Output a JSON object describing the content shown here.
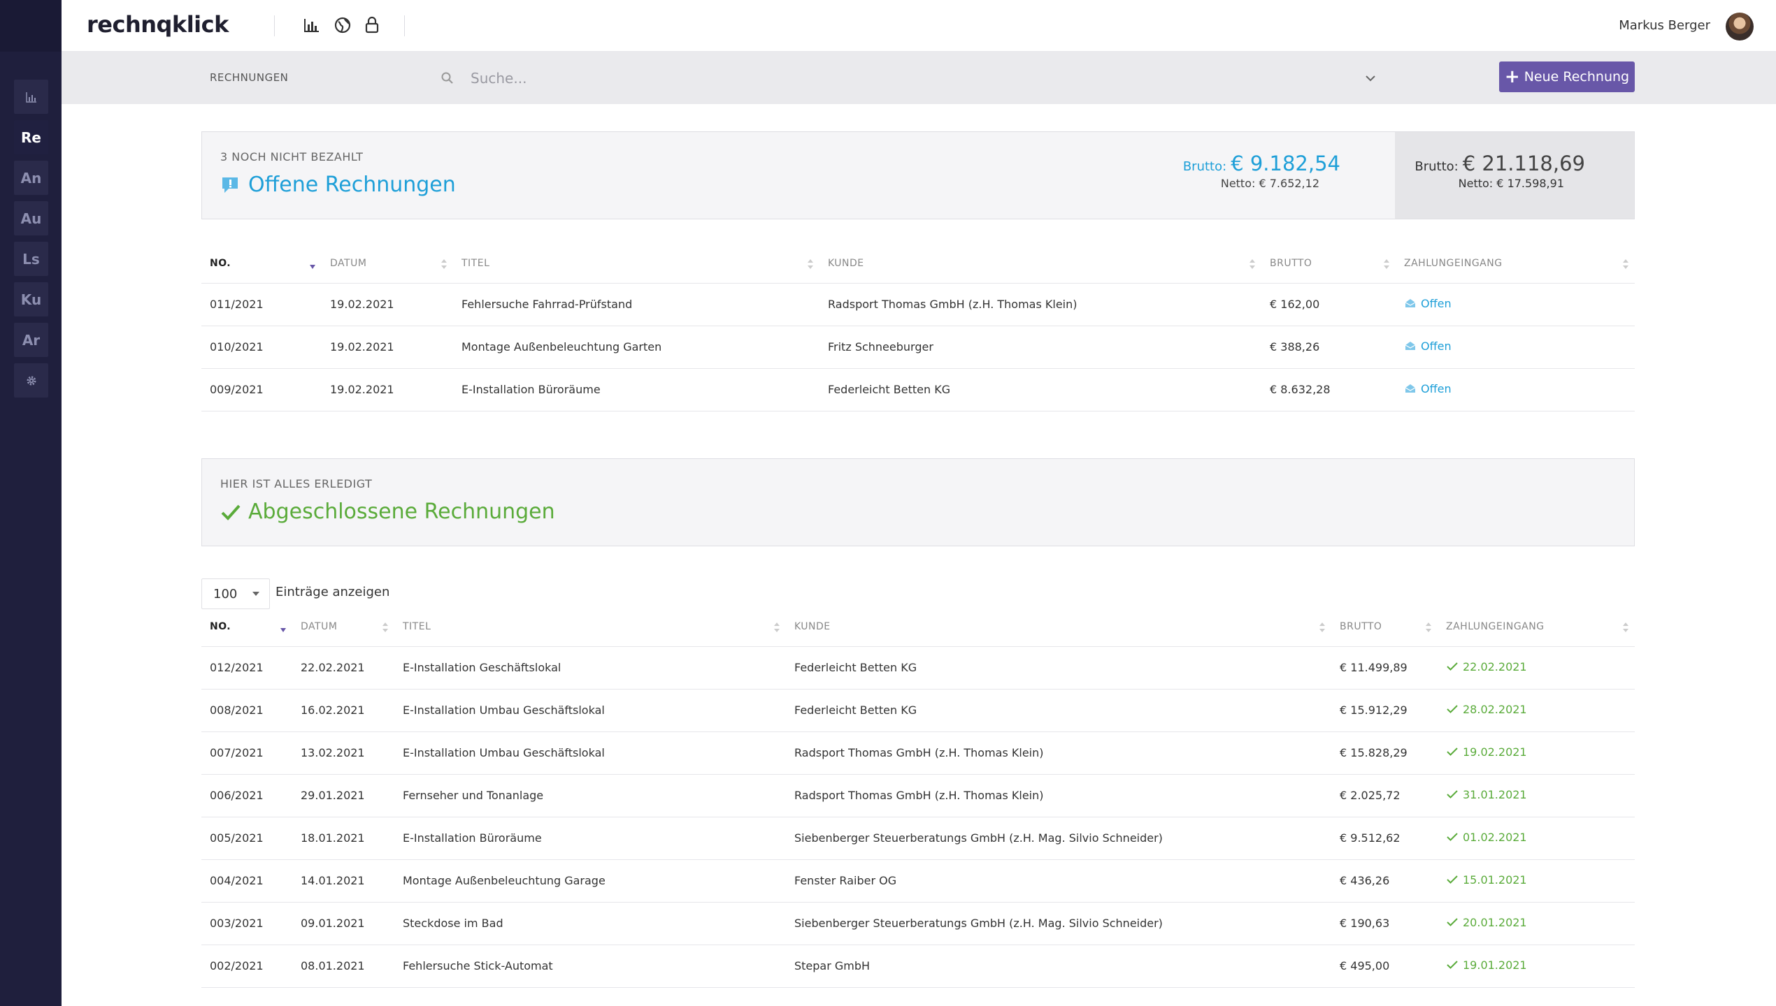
{
  "app": {
    "logo": "rechnqklick"
  },
  "user": {
    "name": "Markus Berger"
  },
  "sidebar": {
    "items": [
      {
        "label": "",
        "icon": "chart-icon"
      },
      {
        "label": "Re",
        "active": true
      },
      {
        "label": "An"
      },
      {
        "label": "Au"
      },
      {
        "label": "Ls"
      },
      {
        "label": "Ku"
      },
      {
        "label": "Ar"
      },
      {
        "label": "",
        "icon": "gear-icon"
      }
    ]
  },
  "header_icons": [
    "chart-icon",
    "globe-icon",
    "lock-icon"
  ],
  "toolbar": {
    "breadcrumb": "RECHNUNGEN",
    "search_placeholder": "Suche...",
    "new_button_label": "Neue Rechnung"
  },
  "open_panel": {
    "eyebrow": "3 NOCH NICHT BEZAHLT",
    "title": "Offene Rechnungen",
    "brutto_label": "Brutto:",
    "brutto_value": "€ 9.182,54",
    "netto_label": "Netto:",
    "netto_value": "€ 7.652,12",
    "total_brutto_label": "Brutto:",
    "total_brutto_value": "€ 21.118,69",
    "total_netto_label": "Netto:",
    "total_netto_value": "€ 17.598,91"
  },
  "open_table": {
    "headers": [
      "NO.",
      "DATUM",
      "TITEL",
      "KUNDE",
      "BRUTTO",
      "ZAHLUNGEINGANG"
    ],
    "rows": [
      [
        "011/2021",
        "19.02.2021",
        "Fehlersuche Fahrrad-Prüfstand",
        "Radsport Thomas GmbH (z.H. Thomas Klein)",
        "€ 162,00",
        "Offen"
      ],
      [
        "010/2021",
        "19.02.2021",
        "Montage Außenbeleuchtung Garten",
        "Fritz Schneeburger",
        "€ 388,26",
        "Offen"
      ],
      [
        "009/2021",
        "19.02.2021",
        "E-Installation Büroräume",
        "Federleicht Betten KG",
        "€ 8.632,28",
        "Offen"
      ]
    ]
  },
  "done_panel": {
    "eyebrow": "HIER IST ALLES ERLEDIGT",
    "title": "Abgeschlossene Rechnungen"
  },
  "page_length": {
    "value": "100",
    "label": "Einträge anzeigen"
  },
  "done_table": {
    "headers": [
      "NO.",
      "DATUM",
      "TITEL",
      "KUNDE",
      "BRUTTO",
      "ZAHLUNGEINGANG"
    ],
    "rows": [
      [
        "012/2021",
        "22.02.2021",
        "E-Installation Geschäftslokal",
        "Federleicht Betten KG",
        "€ 11.499,89",
        "22.02.2021"
      ],
      [
        "008/2021",
        "16.02.2021",
        "E-Installation Umbau Geschäftslokal",
        "Federleicht Betten KG",
        "€ 15.912,29",
        "28.02.2021"
      ],
      [
        "007/2021",
        "13.02.2021",
        "E-Installation Umbau Geschäftslokal",
        "Radsport Thomas GmbH (z.H. Thomas Klein)",
        "€ 15.828,29",
        "19.02.2021"
      ],
      [
        "006/2021",
        "29.01.2021",
        "Fernseher und Tonanlage",
        "Radsport Thomas GmbH (z.H. Thomas Klein)",
        "€ 2.025,72",
        "31.01.2021"
      ],
      [
        "005/2021",
        "18.01.2021",
        "E-Installation Büroräume",
        "Siebenberger Steuerberatungs GmbH (z.H. Mag. Silvio Schneider)",
        "€ 9.512,62",
        "01.02.2021"
      ],
      [
        "004/2021",
        "14.01.2021",
        "Montage Außenbeleuchtung Garage",
        "Fenster Raiber OG",
        "€ 436,26",
        "15.01.2021"
      ],
      [
        "003/2021",
        "09.01.2021",
        "Steckdose im Bad",
        "Siebenberger Steuerberatungs GmbH (z.H. Mag. Silvio Schneider)",
        "€ 190,63",
        "20.01.2021"
      ],
      [
        "002/2021",
        "08.01.2021",
        "Fehlersuche Stick-Automat",
        "Stepar GmbH",
        "€ 495,00",
        "19.01.2021"
      ]
    ]
  },
  "colors": {
    "sidebar": "#1f1f3d",
    "accent_purple": "#6857a8",
    "open_blue": "#1e9fd8",
    "done_green": "#5aab3a"
  }
}
